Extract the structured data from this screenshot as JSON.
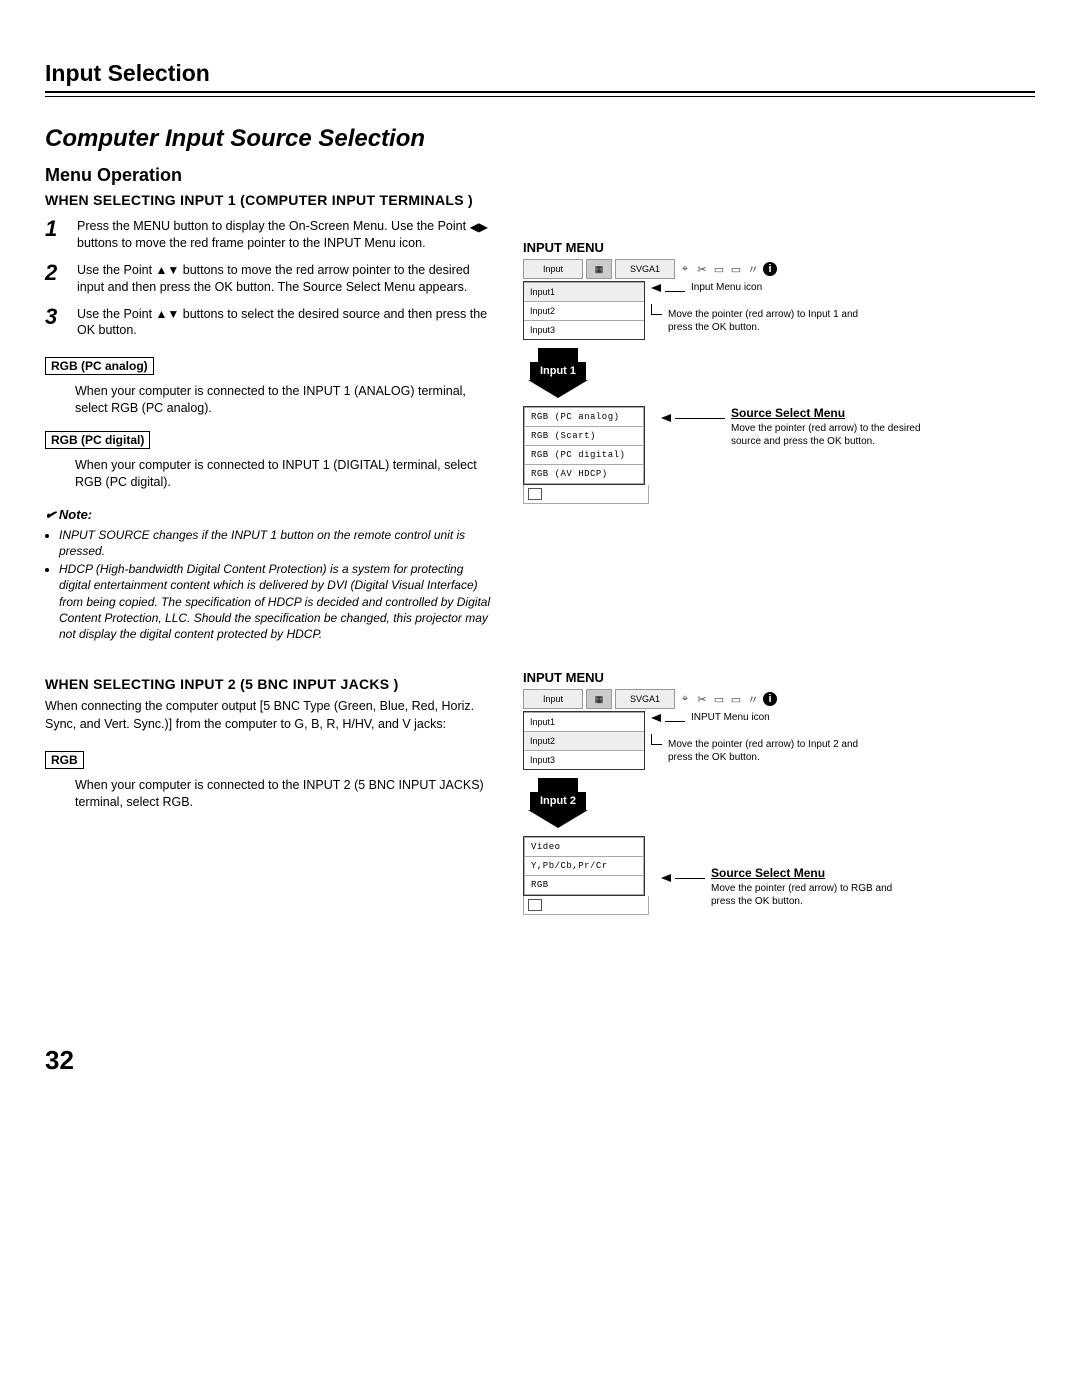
{
  "page_heading": "Input Selection",
  "section_title": "Computer Input Source Selection",
  "subsection": "Menu Operation",
  "block1_heading": "WHEN SELECTING INPUT 1 (COMPUTER INPUT TERMINALS )",
  "step1_num": "1",
  "step1_a": "Press the MENU button to display the On-Screen Menu. Use the Point ",
  "step1_b": " buttons to move the red frame pointer to the INPUT Menu icon.",
  "step2_num": "2",
  "step2_a": "Use the Point ",
  "step2_b": " buttons to move the red arrow pointer to the desired input and then press the OK button. The Source Select Menu appears.",
  "step3_num": "3",
  "step3_a": "Use the Point ",
  "step3_b": " buttons to select the desired source and then press the OK button.",
  "box_rgb_analog": "RGB (PC analog)",
  "desc_rgb_analog": "When your computer is connected to the INPUT 1 (ANALOG) terminal, select RGB (PC analog).",
  "box_rgb_digital": "RGB (PC digital)",
  "desc_rgb_digital": "When your computer is connected to INPUT 1 (DIGITAL) terminal, select RGB (PC digital).",
  "note_head": "Note:",
  "note_items": [
    "INPUT SOURCE changes if the INPUT 1 button on the remote control unit is pressed.",
    "HDCP (High-bandwidth Digital Content Protection) is a system for protecting digital entertainment content which is delivered by DVI (Digital Visual Interface) from being copied. The specification of HDCP is decided and controlled by Digital Content Protection, LLC. Should the specification be changed, this projector may not display the digital content protected by HDCP."
  ],
  "block2_heading": "WHEN SELECTING INPUT 2 (5 BNC INPUT JACKS )",
  "block2_intro": "When connecting the computer output [5 BNC Type (Green, Blue, Red, Horiz. Sync, and Vert. Sync.)] from the computer to G, B, R, H/HV, and V jacks:",
  "box_rgb": "RGB",
  "desc_rgb": "When your computer is connected to the INPUT 2 (5 BNC INPUT JACKS) terminal, select RGB.",
  "page_number": "32",
  "panel1": {
    "title": "INPUT MENU",
    "header": "Input",
    "mode": "SVGA1",
    "inputs": [
      "Input1",
      "Input2",
      "Input3"
    ],
    "callout_icon": "Input Menu icon",
    "callout_move": "Move the pointer (red arrow) to Input 1 and press the OK button.",
    "arrow_label": "Input 1",
    "ssm_title": "Source Select Menu",
    "ssm_desc": "Move the pointer (red arrow) to the desired source and press the OK button.",
    "sources": [
      "RGB (PC analog)",
      "RGB (Scart)",
      "RGB (PC digital)",
      "RGB (AV HDCP)"
    ]
  },
  "panel2": {
    "title": "INPUT MENU",
    "header": "Input",
    "mode": "SVGA1",
    "inputs": [
      "Input1",
      "Input2",
      "Input3"
    ],
    "callout_icon": "INPUT Menu icon",
    "callout_move": "Move the pointer (red arrow) to Input 2 and press the OK button.",
    "arrow_label": "Input 2",
    "ssm_title": "Source Select Menu",
    "ssm_desc": "Move the pointer (red arrow) to RGB and press the OK button.",
    "sources": [
      "Video",
      "Y,Pb/Cb,Pr/Cr",
      "RGB"
    ]
  }
}
